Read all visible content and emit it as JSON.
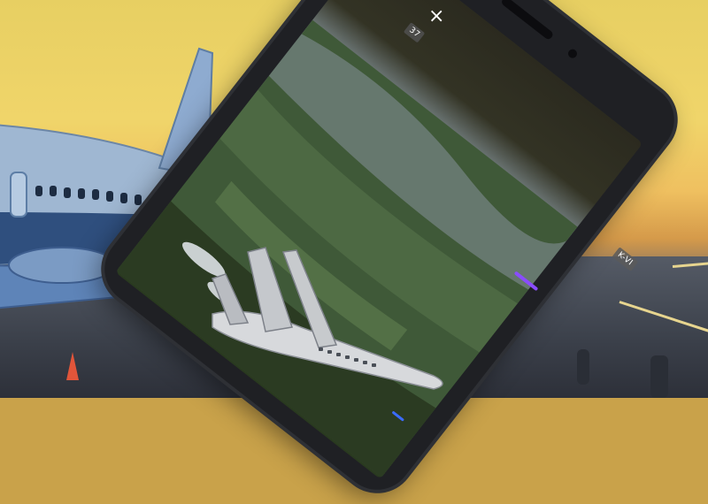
{
  "scene": {
    "description_free": true
  },
  "overlay": {
    "close_label": "×",
    "badge_top": "37",
    "badge_side": "K-VI"
  },
  "colors": {
    "accent": "#8a4cff",
    "phone_body": "#1f2024",
    "sky_top": "#e7cf62",
    "airliner_body": "#9fb7d2"
  },
  "icons": {
    "close": "close-icon",
    "camera": "camera-dot-icon"
  }
}
